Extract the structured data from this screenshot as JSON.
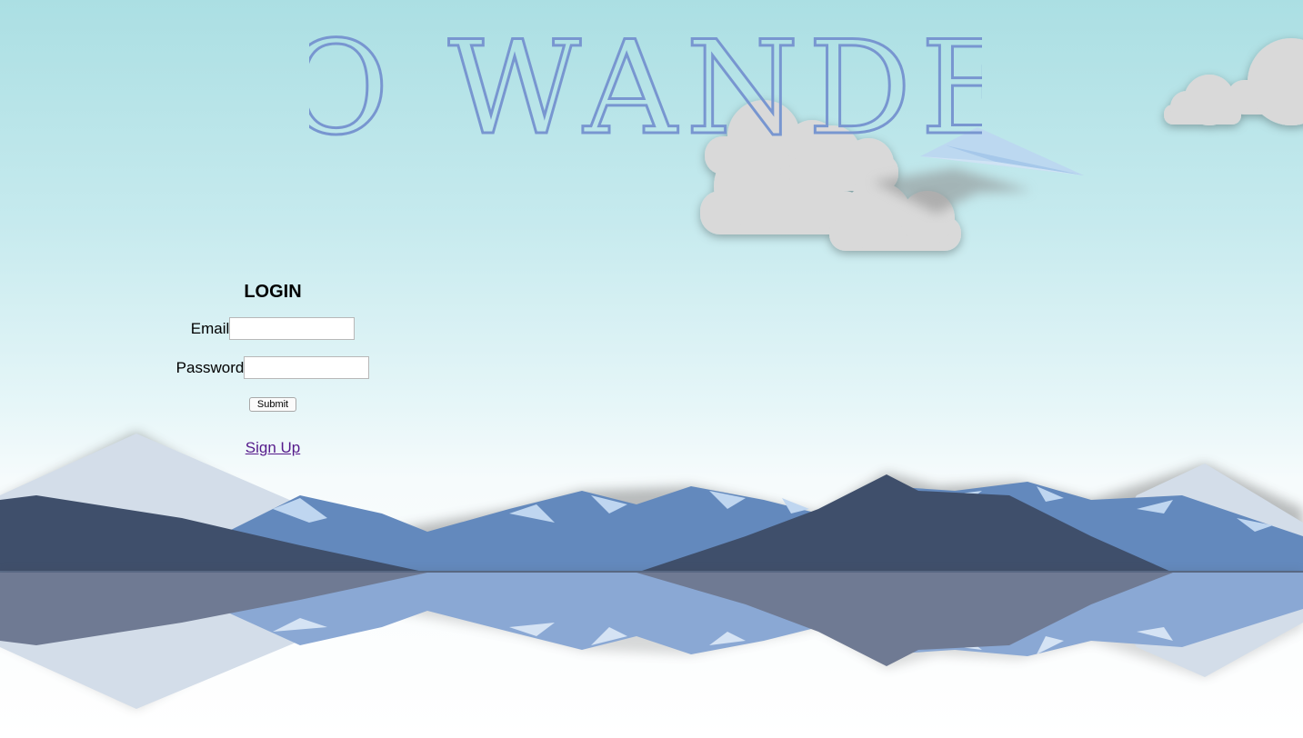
{
  "brand": {
    "title": "NO WANDER"
  },
  "login": {
    "heading": "LOGIN",
    "email_label": "Email",
    "email_value": "",
    "password_label": "Password",
    "password_value": "",
    "submit_label": "Submit",
    "signup_link": "Sign Up"
  },
  "colors": {
    "title": "#7896d0",
    "link": "#551a8b",
    "mountain_dark": "#3f4f6b",
    "mountain_mid": "#5f86bb",
    "mountain_light": "#d2dcea",
    "cloud": "#d8d8d8"
  }
}
